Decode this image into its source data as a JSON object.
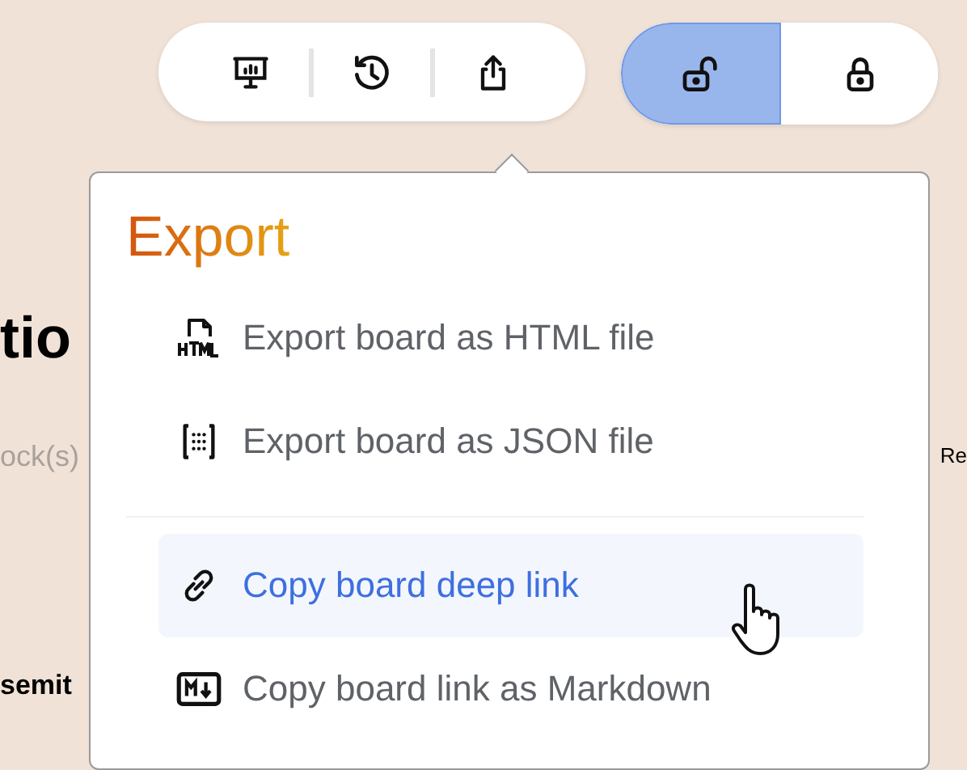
{
  "background_text": [
    {
      "text": "tio",
      "kind": "heading"
    },
    {
      "text": "ock(s)",
      "kind": "muted"
    },
    {
      "text": "Re",
      "kind": "plain"
    },
    {
      "text": "semit",
      "kind": "heading"
    }
  ],
  "toolbar": {
    "buttons": [
      {
        "kind": "present"
      },
      {
        "kind": "history"
      },
      {
        "kind": "share"
      }
    ]
  },
  "lock_toggle": [
    {
      "kind": "unlocked",
      "selected": true
    },
    {
      "kind": "locked",
      "selected": false
    }
  ],
  "menu": {
    "title": "Export",
    "groups": [
      [
        {
          "label": "Export board as HTML file",
          "kind": "html",
          "highlighted": false
        },
        {
          "label": "Export board as JSON file",
          "kind": "json",
          "highlighted": false
        }
      ],
      [
        {
          "label": "Copy board deep link",
          "kind": "link",
          "highlighted": true
        },
        {
          "label": "Copy board link as Markdown",
          "kind": "markdown",
          "highlighted": false
        }
      ]
    ]
  }
}
